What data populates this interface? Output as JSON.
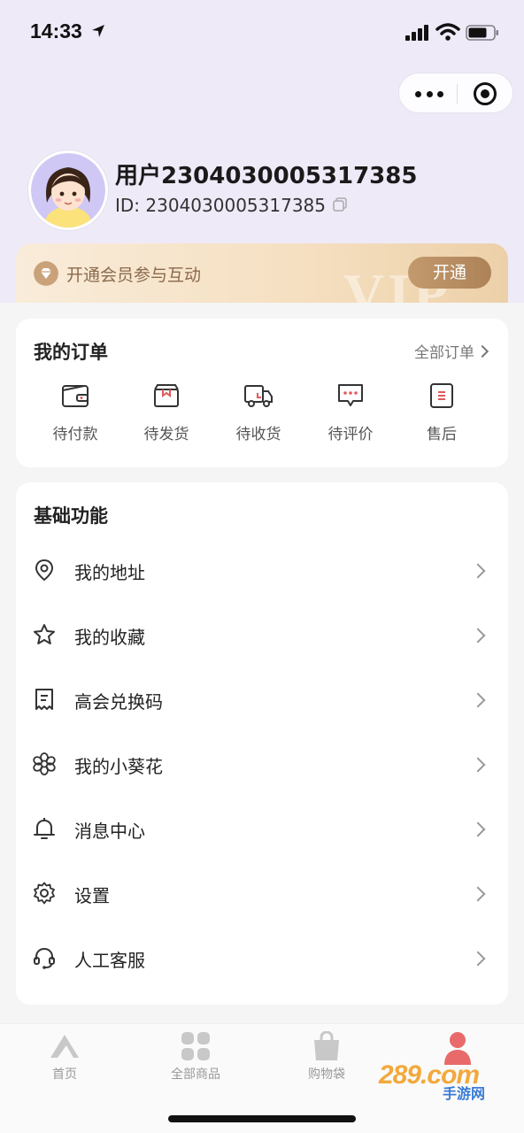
{
  "status_bar": {
    "time": "14:33"
  },
  "profile": {
    "username": "用户2304030005317385",
    "user_id": "ID: 2304030005317385"
  },
  "vip": {
    "text": "开通会员参与互动",
    "button": "开通",
    "watermark": "VIP"
  },
  "orders": {
    "title": "我的订单",
    "all_link": "全部订单",
    "items": [
      {
        "label": "待付款",
        "icon": "wallet-icon"
      },
      {
        "label": "待发货",
        "icon": "box-icon"
      },
      {
        "label": "待收货",
        "icon": "truck-icon"
      },
      {
        "label": "待评价",
        "icon": "comment-icon"
      },
      {
        "label": "售后",
        "icon": "after-sales-icon"
      }
    ]
  },
  "functions": {
    "title": "基础功能",
    "items": [
      {
        "label": "我的地址",
        "icon": "location-icon"
      },
      {
        "label": "我的收藏",
        "icon": "star-icon"
      },
      {
        "label": "高会兑换码",
        "icon": "receipt-icon"
      },
      {
        "label": "我的小葵花",
        "icon": "flower-icon"
      },
      {
        "label": "消息中心",
        "icon": "bell-icon"
      },
      {
        "label": "设置",
        "icon": "gear-icon"
      },
      {
        "label": "人工客服",
        "icon": "headset-icon"
      }
    ]
  },
  "tabbar": {
    "items": [
      {
        "label": "首页",
        "icon": "home-mountain-icon"
      },
      {
        "label": "全部商品",
        "icon": "grid-icon"
      },
      {
        "label": "购物袋",
        "icon": "bag-icon"
      },
      {
        "label": "",
        "icon": "user-icon",
        "active": true
      }
    ]
  },
  "watermark": {
    "text": "289.com",
    "sub": "手游网"
  },
  "colors": {
    "header_bg": "#efeaf8",
    "vip_gold": "#b88c60",
    "order_icon_accent": "#e05a5a",
    "tab_active": "#e86a6a"
  }
}
